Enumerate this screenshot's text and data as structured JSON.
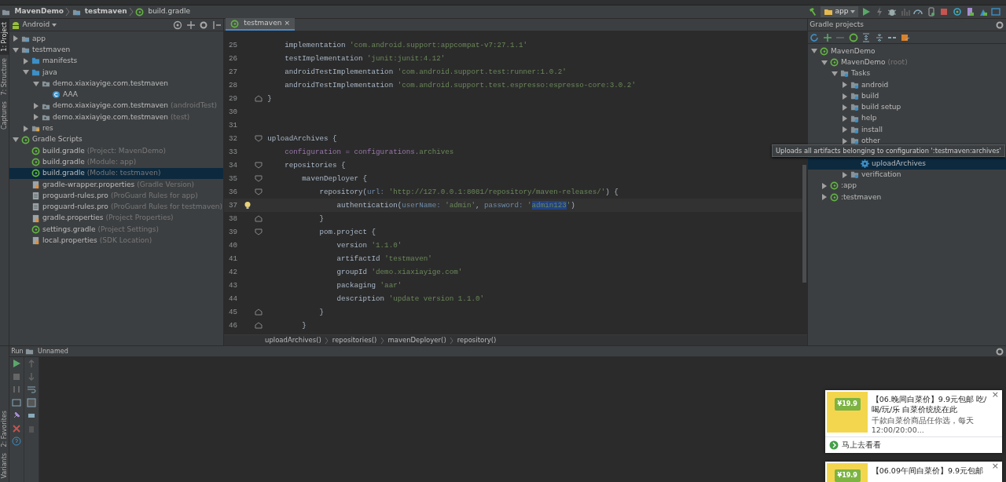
{
  "navbar": {
    "breadcrumb": [
      {
        "label": "MavenDemo",
        "kind": "project"
      },
      {
        "label": "testmaven",
        "kind": "module"
      },
      {
        "label": "build.gradle",
        "kind": "gradle"
      }
    ],
    "run_config": "app"
  },
  "left_tool_strip": [
    {
      "label": "1: Project",
      "selected": true
    },
    {
      "label": "7: Structure",
      "selected": false
    },
    {
      "label": "Captures",
      "selected": false
    }
  ],
  "project_panel": {
    "view": "Android",
    "tree": [
      {
        "label": "app",
        "kind": "module",
        "expanded": false,
        "selected": false
      },
      {
        "label": "testmaven",
        "kind": "module",
        "expanded": true,
        "selected": false,
        "children": [
          {
            "label": "manifests",
            "kind": "folder",
            "expanded": false,
            "selected": false
          },
          {
            "label": "java",
            "kind": "folder",
            "expanded": true,
            "selected": false,
            "children": [
              {
                "label": "demo.xiaxiayige.com.testmaven",
                "kind": "package",
                "expanded": true,
                "selected": false,
                "children": [
                  {
                    "label": "AAA",
                    "kind": "class",
                    "selected": false
                  }
                ]
              },
              {
                "label": "demo.xiaxiayige.com.testmaven",
                "note": "(androidTest)",
                "kind": "package",
                "expanded": false,
                "selected": false
              },
              {
                "label": "demo.xiaxiayige.com.testmaven",
                "note": "(test)",
                "kind": "package",
                "expanded": false,
                "selected": false
              }
            ]
          },
          {
            "label": "res",
            "kind": "res",
            "expanded": false,
            "selected": false
          }
        ]
      },
      {
        "label": "Gradle Scripts",
        "kind": "gradle",
        "expanded": true,
        "selected": false,
        "children": [
          {
            "label": "build.gradle",
            "note": "(Project: MavenDemo)",
            "kind": "gradle",
            "selected": false
          },
          {
            "label": "build.gradle",
            "note": "(Module: app)",
            "kind": "gradle",
            "selected": false
          },
          {
            "label": "build.gradle",
            "note": "(Module: testmaven)",
            "kind": "gradle",
            "selected": true
          },
          {
            "label": "gradle-wrapper.properties",
            "note": "(Gradle Version)",
            "kind": "props",
            "selected": false
          },
          {
            "label": "proguard-rules.pro",
            "note": "(ProGuard Rules for app)",
            "kind": "file",
            "selected": false
          },
          {
            "label": "proguard-rules.pro",
            "note": "(ProGuard Rules for testmaven)",
            "kind": "file",
            "selected": false
          },
          {
            "label": "gradle.properties",
            "note": "(Project Properties)",
            "kind": "props",
            "selected": false
          },
          {
            "label": "settings.gradle",
            "note": "(Project Settings)",
            "kind": "gradle",
            "selected": false
          },
          {
            "label": "local.properties",
            "note": "(SDK Location)",
            "kind": "props",
            "selected": false
          }
        ]
      }
    ]
  },
  "editor": {
    "tabs": [
      {
        "label": "testmaven",
        "close": "×",
        "selected": true
      }
    ],
    "lines": [
      {
        "number": "25",
        "tokens": [
          {
            "text": "    implementation ",
            "kind": "plain"
          },
          {
            "text": "'com.android.support:appcompat-v7:27.1.1'",
            "kind": "string"
          }
        ]
      },
      {
        "number": "26",
        "tokens": [
          {
            "text": "    testImplementation ",
            "kind": "plain"
          },
          {
            "text": "'junit:junit:4.12'",
            "kind": "string"
          }
        ]
      },
      {
        "number": "27",
        "tokens": [
          {
            "text": "    androidTestImplementation ",
            "kind": "plain"
          },
          {
            "text": "'com.android.support.test:runner:1.0.2'",
            "kind": "string"
          }
        ]
      },
      {
        "number": "28",
        "tokens": [
          {
            "text": "    androidTestImplementation ",
            "kind": "plain"
          },
          {
            "text": "'com.android.support.test.espresso:espresso-core:3.0.2'",
            "kind": "string"
          }
        ]
      },
      {
        "number": "29",
        "fold_end": true,
        "tokens": [
          {
            "text": "}",
            "kind": "plain"
          }
        ]
      },
      {
        "number": "30"
      },
      {
        "number": "31"
      },
      {
        "number": "32",
        "fold_start": true,
        "tokens": [
          {
            "text": "uploadArchives {",
            "kind": "plain"
          }
        ]
      },
      {
        "number": "33",
        "tokens": [
          {
            "text": "    configuration = ",
            "kind": "prop"
          },
          {
            "text": "configurations.",
            "kind": "prop"
          },
          {
            "text": "archives",
            "kind": "string"
          }
        ]
      },
      {
        "number": "34",
        "fold_start": true,
        "tokens": [
          {
            "text": "    repositories {",
            "kind": "plain"
          }
        ]
      },
      {
        "number": "35",
        "fold_start": true,
        "tokens": [
          {
            "text": "        mavenDeployer {",
            "kind": "plain"
          }
        ]
      },
      {
        "number": "36",
        "fold_start": true,
        "tokens": [
          {
            "text": "            repository(",
            "kind": "plain"
          },
          {
            "text": "url: ",
            "kind": "param"
          },
          {
            "text": "'http://127.0.0.1:8081/repository/maven-releases/'",
            "kind": "string"
          },
          {
            "text": ") {",
            "kind": "plain"
          }
        ]
      },
      {
        "number": "37",
        "current": true,
        "tokens": [
          {
            "text": "                authentication(",
            "kind": "plain"
          },
          {
            "text": "userName: ",
            "kind": "param"
          },
          {
            "text": "'admin'",
            "kind": "string"
          },
          {
            "text": ", ",
            "kind": "plain"
          },
          {
            "text": "password: ",
            "kind": "param"
          },
          {
            "text": "'",
            "kind": "string"
          },
          {
            "text": "admin123",
            "kind": "selected"
          },
          {
            "text": "'",
            "kind": "string"
          },
          {
            "text": ")",
            "kind": "plain"
          }
        ]
      },
      {
        "number": "38",
        "fold_end": true,
        "tokens": [
          {
            "text": "            }",
            "kind": "plain"
          }
        ]
      },
      {
        "number": "39",
        "fold_start": true,
        "tokens": [
          {
            "text": "            pom.project {",
            "kind": "plain"
          }
        ]
      },
      {
        "number": "40",
        "tokens": [
          {
            "text": "                version ",
            "kind": "plain"
          },
          {
            "text": "'1.1.0'",
            "kind": "string"
          }
        ]
      },
      {
        "number": "41",
        "tokens": [
          {
            "text": "                artifactId ",
            "kind": "plain"
          },
          {
            "text": "'testmaven'",
            "kind": "string"
          }
        ]
      },
      {
        "number": "42",
        "tokens": [
          {
            "text": "                groupId ",
            "kind": "plain"
          },
          {
            "text": "'demo.xiaxiayige.com'",
            "kind": "string"
          }
        ]
      },
      {
        "number": "43",
        "tokens": [
          {
            "text": "                packaging ",
            "kind": "plain"
          },
          {
            "text": "'aar'",
            "kind": "string"
          }
        ]
      },
      {
        "number": "44",
        "tokens": [
          {
            "text": "                description ",
            "kind": "plain"
          },
          {
            "text": "'update version 1.1.0'",
            "kind": "string"
          }
        ]
      },
      {
        "number": "45",
        "fold_end": true,
        "tokens": [
          {
            "text": "            }",
            "kind": "plain"
          }
        ]
      },
      {
        "number": "46",
        "fold_end": true,
        "tokens": [
          {
            "text": "        }",
            "kind": "plain"
          }
        ]
      }
    ],
    "breadcrumbs": [
      "uploadArchives()",
      "repositories()",
      "mavenDeployer()",
      "repository()"
    ]
  },
  "gradle_panel": {
    "title": "Gradle projects",
    "tree": [
      {
        "label": "MavenDemo",
        "kind": "gradle",
        "expanded": true,
        "selected": false,
        "children": [
          {
            "label": "MavenDemo",
            "note": "(root)",
            "kind": "gradle",
            "expanded": true,
            "selected": false,
            "children": [
              {
                "label": "Tasks",
                "kind": "tasks",
                "expanded": true,
                "selected": false,
                "children": [
                  {
                    "label": "android",
                    "kind": "tasks",
                    "expanded": false,
                    "selected": false
                  },
                  {
                    "label": "build",
                    "kind": "tasks",
                    "expanded": false,
                    "selected": false
                  },
                  {
                    "label": "build setup",
                    "kind": "tasks",
                    "expanded": false,
                    "selected": false
                  },
                  {
                    "label": "help",
                    "kind": "tasks",
                    "expanded": false,
                    "selected": false
                  },
                  {
                    "label": "install",
                    "kind": "tasks",
                    "expanded": false,
                    "selected": false
                  },
                  {
                    "label": "other",
                    "kind": "tasks",
                    "expanded": false,
                    "selected": false
                  },
                  {
                    "kind": "hidden",
                    "children": [
                      {
                        "label": "uploadArchives",
                        "kind": "task",
                        "selected": true
                      }
                    ]
                  },
                  {
                    "label": "verification",
                    "kind": "tasks",
                    "expanded": false,
                    "selected": false
                  }
                ]
              }
            ]
          },
          {
            "label": ":app",
            "kind": "gradle",
            "expanded": false,
            "selected": false
          },
          {
            "label": ":testmaven",
            "kind": "gradle",
            "expanded": false,
            "selected": false
          }
        ]
      }
    ],
    "tooltip": "Uploads all artifacts belonging to configuration ':testmaven:archives'"
  },
  "run_panel": {
    "title": "Run",
    "config": "Unnamed"
  },
  "bottom_tool_strip": [
    {
      "label": "2: Favorites"
    },
    {
      "label": "Variants"
    }
  ],
  "notifications": [
    {
      "title": "【06.晚间白菜价】9.9元包邮 吃/喝/玩/乐 白菜价统统在此",
      "subtitle": "千款白菜价商品任你选，每天12:00/20:00...",
      "action": "马上去看看",
      "price": "¥19.9",
      "close": "×"
    },
    {
      "title": "【06.09午间白菜价】9.9元包邮",
      "price": "¥19.9",
      "close": "×"
    }
  ]
}
